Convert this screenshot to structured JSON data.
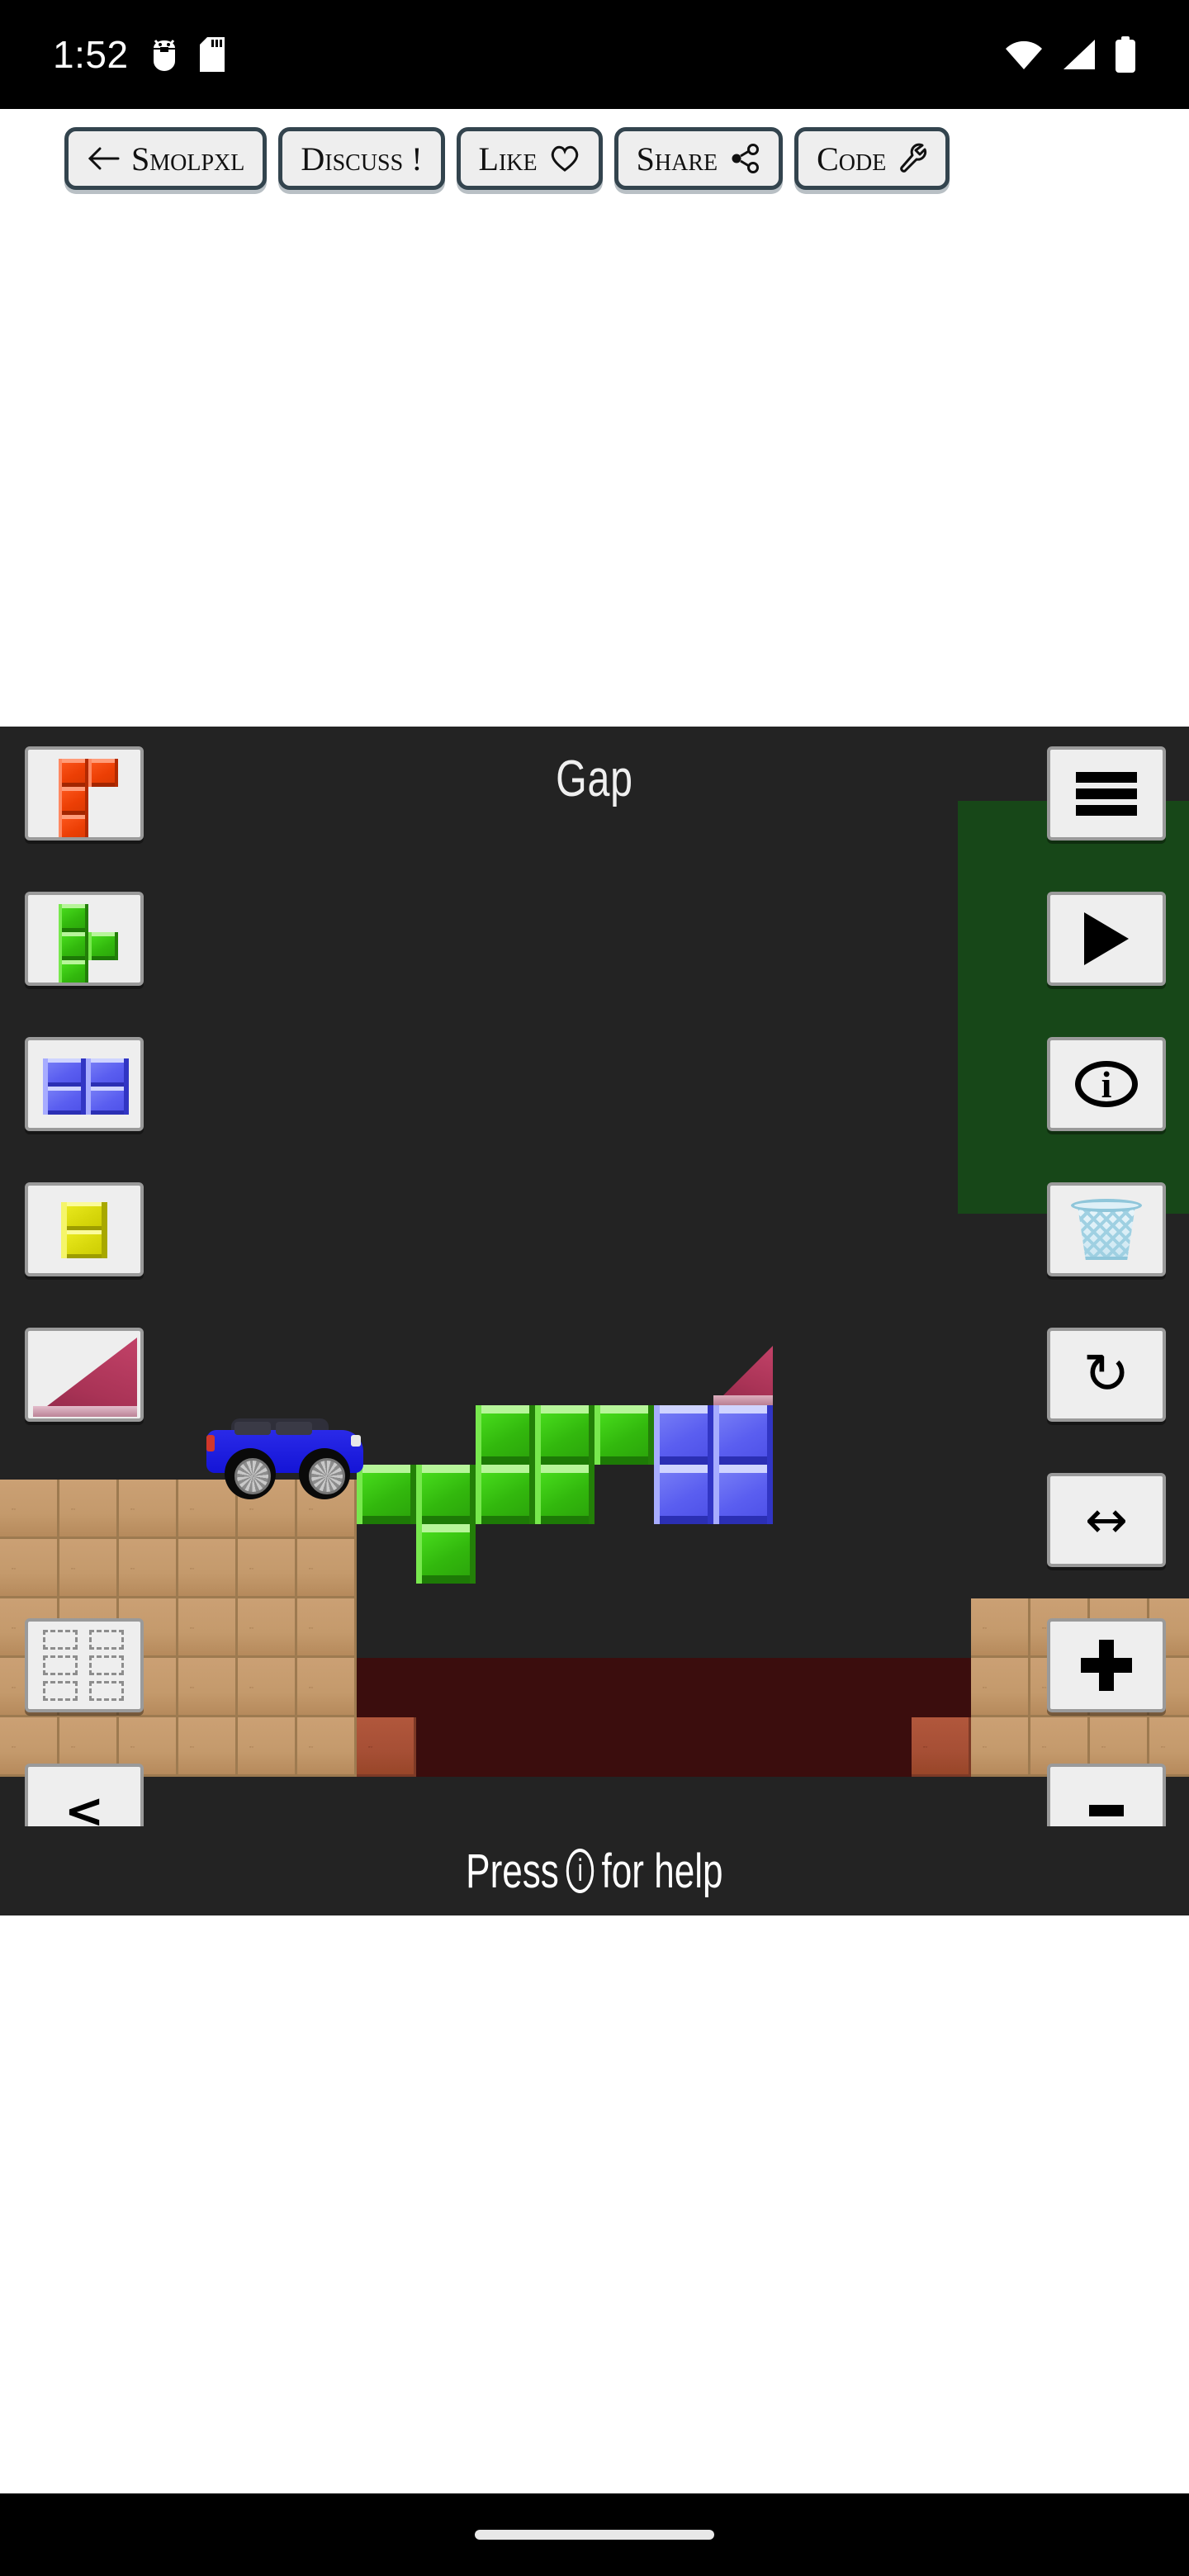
{
  "status_bar": {
    "time": "1:52",
    "icons_left": [
      "android-debug-icon",
      "sd-card-icon"
    ],
    "icons_right": [
      "wifi-icon",
      "cellular-signal-icon",
      "battery-icon"
    ]
  },
  "top_toolbar": {
    "buttons": [
      {
        "label": "Smolpxl",
        "icon": "arrow-left-icon",
        "icon_side": "left"
      },
      {
        "label": "Discuss !",
        "icon": "",
        "icon_side": ""
      },
      {
        "label": "Like",
        "icon": "heart-icon",
        "icon_side": "right"
      },
      {
        "label": "Share",
        "icon": "share-nodes-icon",
        "icon_side": "right"
      },
      {
        "label": "Code",
        "icon": "wrench-icon",
        "icon_side": "right"
      }
    ]
  },
  "game": {
    "title": "Gap",
    "hint_prefix": "Press",
    "hint_icon": "i",
    "hint_suffix": "for help",
    "background_color": "#232323",
    "left_tools": [
      {
        "name": "block-red-j-piece",
        "type": "palette",
        "color": "#ec3f05",
        "selected": false
      },
      {
        "name": "block-green-t-piece",
        "type": "palette",
        "color": "#32b80d",
        "selected": false
      },
      {
        "name": "block-blue-square",
        "type": "palette",
        "color": "#5a5ef0",
        "selected": false
      },
      {
        "name": "block-yellow-domino",
        "type": "palette",
        "color": "#d8d80c",
        "selected": false
      },
      {
        "name": "block-magenta-ramp",
        "type": "palette",
        "color": "#a93356",
        "selected": true
      },
      {
        "name": "eraser-tool",
        "type": "eraser",
        "color": "#8d8d8d",
        "selected": false
      }
    ],
    "right_tools": [
      {
        "name": "menu-button",
        "icon": "hamburger-icon"
      },
      {
        "name": "play-button",
        "icon": "play-icon"
      },
      {
        "name": "info-button",
        "icon": "info-icon"
      },
      {
        "name": "trash-button",
        "icon": "trash-basket-icon"
      },
      {
        "name": "rotate-button",
        "icon": "rotate-cw-icon"
      },
      {
        "name": "flip-button",
        "icon": "arrows-left-right-icon"
      },
      {
        "name": "zoom-in-button",
        "icon": "plus-icon"
      }
    ],
    "back_button": {
      "name": "back-button",
      "label": "<"
    },
    "zoom_out_button": {
      "name": "zoom-out-button",
      "label": "-"
    }
  },
  "colors": {
    "toolbar_border": "#33444e",
    "button_face": "#eeeeee",
    "wood": "#c49a6c",
    "wood_red": "#a64f35",
    "pit": "#3b0d0d",
    "green_wall": "#174718",
    "car_body": "#1414d6"
  }
}
